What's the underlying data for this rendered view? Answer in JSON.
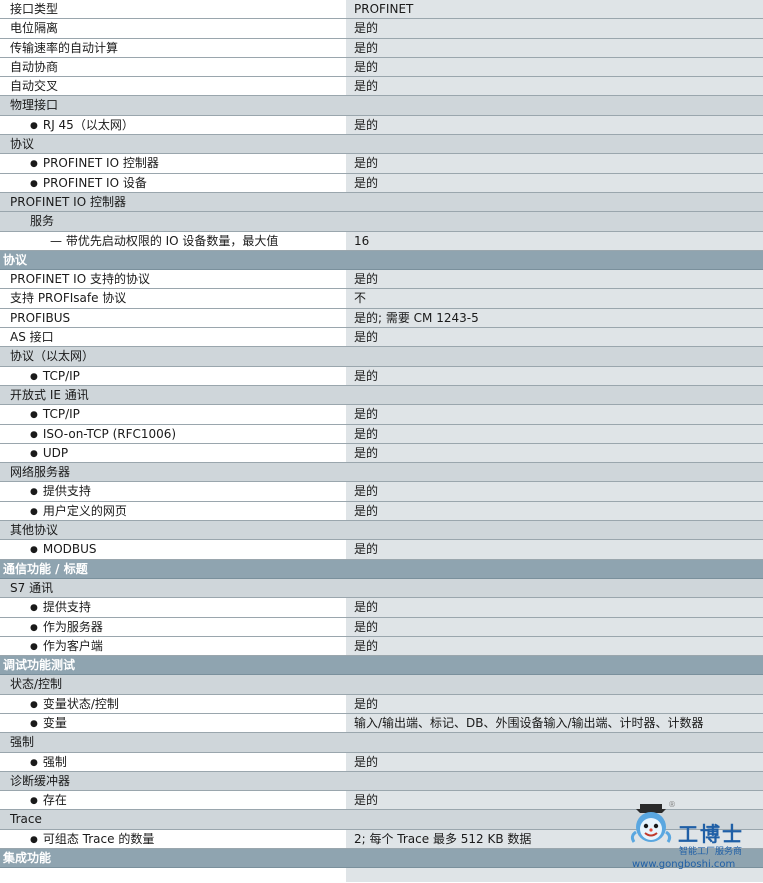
{
  "rows": [
    {
      "type": "data",
      "label": "接口类型",
      "value": "PROFINET"
    },
    {
      "type": "data",
      "label": "电位隔离",
      "value": "是的"
    },
    {
      "type": "data",
      "label": "传输速率的自动计算",
      "value": "是的"
    },
    {
      "type": "data",
      "label": "自动协商",
      "value": "是的"
    },
    {
      "type": "data",
      "label": "自动交叉",
      "value": "是的"
    },
    {
      "type": "group",
      "label": "物理接口",
      "value": ""
    },
    {
      "type": "bullet",
      "label": "RJ 45（以太网）",
      "value": "是的"
    },
    {
      "type": "group",
      "label": "协议",
      "value": ""
    },
    {
      "type": "bullet",
      "label": "PROFINET IO 控制器",
      "value": "是的"
    },
    {
      "type": "bullet",
      "label": "PROFINET IO 设备",
      "value": "是的"
    },
    {
      "type": "group",
      "label": "PROFINET IO 控制器",
      "value": ""
    },
    {
      "type": "group-l1",
      "label": "服务",
      "value": ""
    },
    {
      "type": "data-l2",
      "label": "— 带优先启动权限的 IO 设备数量，最大值",
      "value": "16"
    },
    {
      "type": "section",
      "label": "协议"
    },
    {
      "type": "data",
      "label": "PROFINET IO 支持的协议",
      "value": "是的"
    },
    {
      "type": "data",
      "label": "支持 PROFIsafe 协议",
      "value": "不"
    },
    {
      "type": "data",
      "label": "PROFIBUS",
      "value": "是的; 需要 CM 1243-5"
    },
    {
      "type": "data",
      "label": "AS 接口",
      "value": "是的"
    },
    {
      "type": "group",
      "label": "协议（以太网）",
      "value": ""
    },
    {
      "type": "bullet",
      "label": "TCP/IP",
      "value": "是的"
    },
    {
      "type": "group",
      "label": "开放式 IE 通讯",
      "value": ""
    },
    {
      "type": "bullet",
      "label": "TCP/IP",
      "value": "是的"
    },
    {
      "type": "bullet",
      "label": "ISO-on-TCP (RFC1006)",
      "value": "是的"
    },
    {
      "type": "bullet",
      "label": "UDP",
      "value": "是的"
    },
    {
      "type": "group",
      "label": "网络服务器",
      "value": ""
    },
    {
      "type": "bullet",
      "label": "提供支持",
      "value": "是的"
    },
    {
      "type": "bullet",
      "label": "用户定义的网页",
      "value": "是的"
    },
    {
      "type": "group",
      "label": "其他协议",
      "value": ""
    },
    {
      "type": "bullet",
      "label": "MODBUS",
      "value": "是的"
    },
    {
      "type": "section",
      "label": "通信功能 / 标题"
    },
    {
      "type": "group",
      "label": "S7 通讯",
      "value": ""
    },
    {
      "type": "bullet",
      "label": "提供支持",
      "value": "是的"
    },
    {
      "type": "bullet",
      "label": "作为服务器",
      "value": "是的"
    },
    {
      "type": "bullet",
      "label": "作为客户端",
      "value": "是的"
    },
    {
      "type": "section",
      "label": "调试功能测试"
    },
    {
      "type": "group",
      "label": "状态/控制",
      "value": ""
    },
    {
      "type": "bullet",
      "label": "变量状态/控制",
      "value": "是的"
    },
    {
      "type": "bullet",
      "label": "变量",
      "value": "输入/输出端、标记、DB、外围设备输入/输出端、计时器、计数器"
    },
    {
      "type": "group",
      "label": "强制",
      "value": ""
    },
    {
      "type": "bullet",
      "label": "强制",
      "value": "是的"
    },
    {
      "type": "group",
      "label": "诊断缓冲器",
      "value": ""
    },
    {
      "type": "bullet",
      "label": "存在",
      "value": "是的"
    },
    {
      "type": "group",
      "label": "Trace",
      "value": ""
    },
    {
      "type": "bullet",
      "label": "可组态 Trace 的数量",
      "value": "2; 每个 Trace 最多 512 KB 数据"
    },
    {
      "type": "section",
      "label": "集成功能"
    },
    {
      "type": "tail",
      "label": "",
      "value": ""
    }
  ],
  "watermark": {
    "brand": "工博士",
    "tagline": "智能工厂服务商",
    "url": "www.gongboshi.com",
    "registered": "®"
  },
  "colors": {
    "section_bg": "#8fa4b0",
    "group_bg": "#cfd6da",
    "value_bg": "#dfe4e7",
    "brand_blue": "#1f5fa6"
  }
}
